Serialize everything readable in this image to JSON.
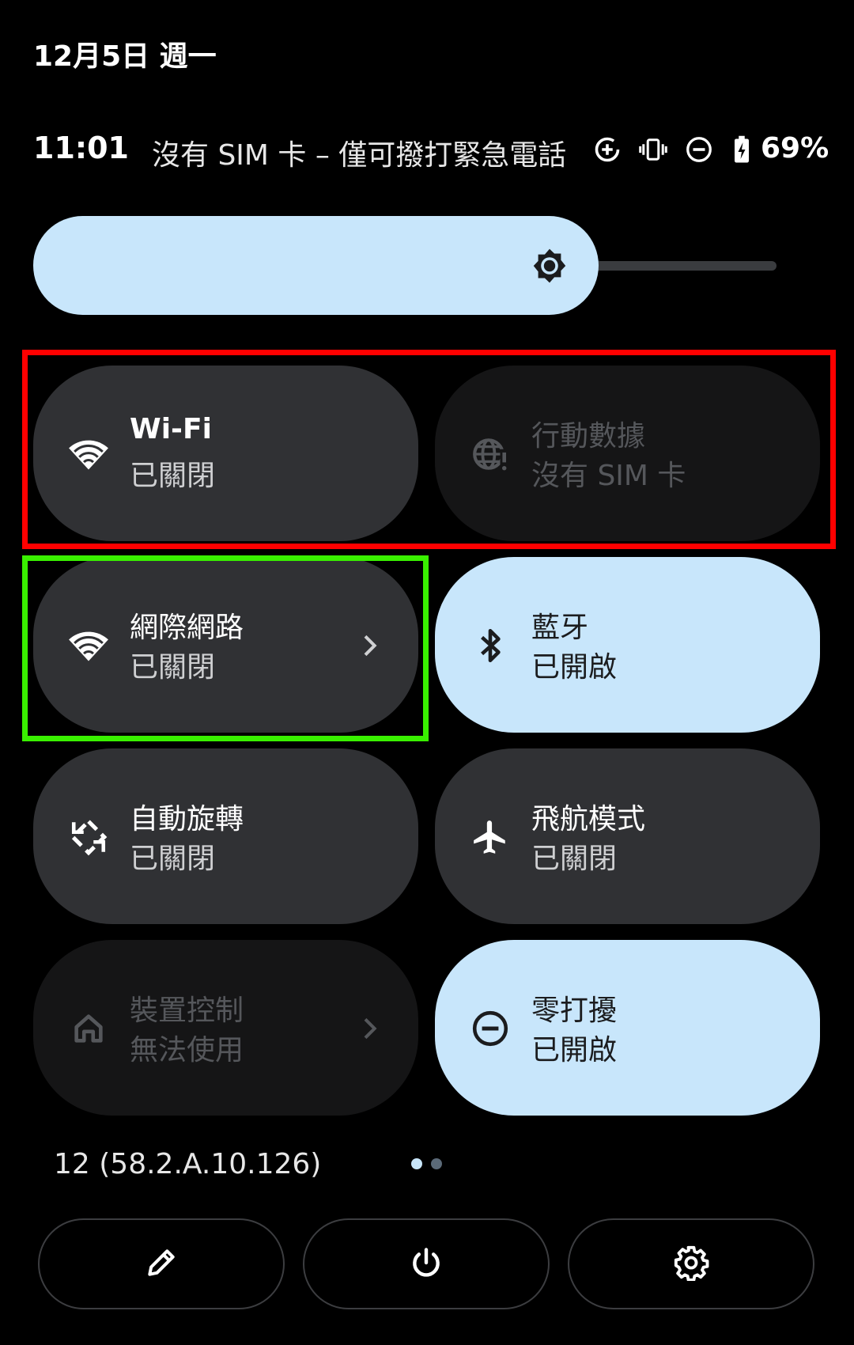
{
  "header": {
    "date": "12月5日 週一",
    "time": "11:01",
    "carrier": "沒有 SIM 卡 – 僅可撥打緊急電話",
    "battery": "69%",
    "status_icons": [
      "data-saver-icon",
      "vibrate-icon",
      "do-not-disturb-icon",
      "battery-charging-icon"
    ]
  },
  "brightness": {
    "level": 0.76,
    "icon": "brightness-icon"
  },
  "tiles": [
    {
      "title": "Wi-Fi",
      "subtitle": "已關閉",
      "state": "off",
      "icon": "wifi-icon"
    },
    {
      "title": "行動數據",
      "subtitle": "沒有 SIM 卡",
      "state": "disabled",
      "icon": "mobile-data-icon"
    },
    {
      "title": "網際網路",
      "subtitle": "已關閉",
      "state": "off",
      "icon": "wifi-icon",
      "has_chevron": true
    },
    {
      "title": "藍牙",
      "subtitle": "已開啟",
      "state": "on",
      "icon": "bluetooth-icon"
    },
    {
      "title": "自動旋轉",
      "subtitle": "已關閉",
      "state": "off",
      "icon": "auto-rotate-icon"
    },
    {
      "title": "飛航模式",
      "subtitle": "已關閉",
      "state": "off",
      "icon": "airplane-icon"
    },
    {
      "title": "裝置控制",
      "subtitle": "無法使用",
      "state": "disabled",
      "icon": "home-icon",
      "has_chevron": true
    },
    {
      "title": "零打擾",
      "subtitle": "已開啟",
      "state": "on",
      "icon": "do-not-disturb-icon"
    }
  ],
  "footer": {
    "build": "12 (58.2.A.10.126)",
    "page_count": 2,
    "current_page": 1,
    "buttons": [
      "edit-icon",
      "power-icon",
      "settings-icon"
    ]
  },
  "colors": {
    "background": "#000000",
    "tile_off": "#303134",
    "tile_on": "#c8e6fb",
    "tile_disabled": "#151516",
    "highlight_red": "#ff0000",
    "highlight_green": "#39f000"
  }
}
